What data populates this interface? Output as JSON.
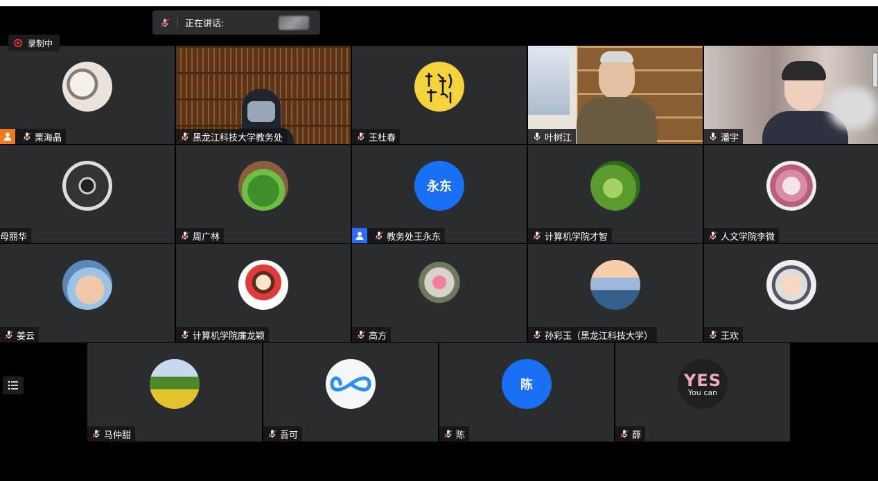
{
  "speaking_bar": {
    "label": "正在讲话:"
  },
  "recording": {
    "label": "录制中"
  },
  "colors": {
    "accent_blue": "#1a6ff5",
    "host_orange": "#f07a1f",
    "rec_red": "#e03232",
    "tile_bg": "#2a2c30"
  },
  "participants": [
    {
      "name": "栗海晶",
      "mic": "muted",
      "badge": "host",
      "avatar": "photo-cat"
    },
    {
      "name": "黑龙江科技大学教务处",
      "mic": "muted",
      "video": "library-man"
    },
    {
      "name": "王杜春",
      "mic": "muted",
      "avatar": "calligraphy"
    },
    {
      "name": "叶树江",
      "mic": "on",
      "video": "bookshelf-man"
    },
    {
      "name": "潘宇",
      "mic": "on",
      "video": "woman-glasses"
    },
    {
      "name": "母丽华",
      "mic": "none",
      "avatar": "photo-wheel"
    },
    {
      "name": "周广林",
      "mic": "muted",
      "avatar": "photo-plant"
    },
    {
      "name": "教务处王永东",
      "mic": "muted",
      "badge": "cohost",
      "avatar_text": "永东",
      "avatar": "text-blue"
    },
    {
      "name": "计算机学院才智",
      "mic": "muted",
      "avatar": "photo-bird"
    },
    {
      "name": "人文学院李微",
      "mic": "muted",
      "avatar": "photo-flowers-woman"
    },
    {
      "name": "姜云",
      "mic": "muted",
      "avatar": "photo-baby"
    },
    {
      "name": "计算机学院廉龙颖",
      "mic": "muted",
      "avatar": "cartoon-girl"
    },
    {
      "name": "高方",
      "mic": "muted",
      "avatar": "photo-tulips"
    },
    {
      "name": "孙彩玉（黑龙江科技大学）",
      "mic": "muted",
      "avatar": "photo-sea"
    },
    {
      "name": "王欢",
      "mic": "muted",
      "avatar": "photo-toddler"
    }
  ],
  "participants_row4": [
    {
      "name": "马仲甜",
      "mic": "muted",
      "avatar": "photo-field"
    },
    {
      "name": "吾可",
      "mic": "muted",
      "avatar": "infinity-logo"
    },
    {
      "name": "陈",
      "mic": "muted",
      "avatar_text": "陈",
      "avatar": "text-blue"
    },
    {
      "name": "薛",
      "mic": "muted",
      "avatar": "yes-you-can",
      "avatar_lines": [
        "YES",
        "You can"
      ]
    }
  ]
}
